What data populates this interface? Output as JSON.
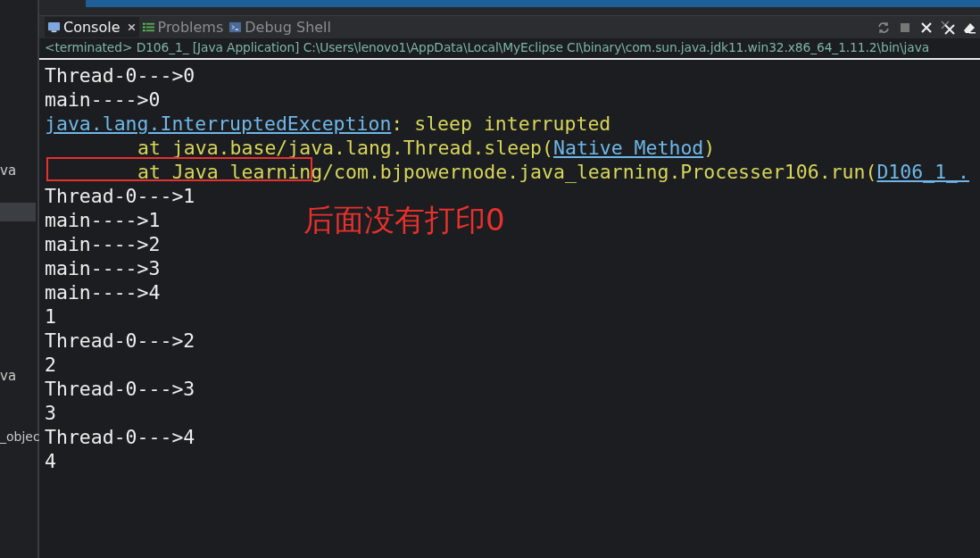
{
  "sidebar": {
    "items": [
      {
        "label": "va",
        "selected": false
      },
      {
        "selected": true
      },
      {
        "label": "va",
        "selected": false
      },
      {
        "label": "_objec",
        "selected": false
      }
    ]
  },
  "tabs": [
    {
      "label": "Console",
      "selected": true,
      "closable": true
    },
    {
      "label": "Problems",
      "selected": false,
      "closable": false
    },
    {
      "label": "Debug Shell",
      "selected": false,
      "closable": false
    }
  ],
  "status_line": "<terminated> D106_1_ [Java Application] C:\\Users\\lenovo1\\AppData\\Local\\MyEclipse CI\\binary\\com.sun.java.jdk11.win32.x86_64_1.11.2\\bin\\java",
  "console_lines": [
    {
      "kind": "line",
      "segments": [
        {
          "kind": "out",
          "text": "Thread-0--->0"
        }
      ]
    },
    {
      "kind": "line",
      "segments": [
        {
          "kind": "out",
          "text": "main---->0"
        }
      ]
    },
    {
      "kind": "line",
      "segments": [
        {
          "kind": "link",
          "text": "java.lang.InterruptedException"
        },
        {
          "kind": "err",
          "text": ": sleep interrupted"
        }
      ]
    },
    {
      "kind": "frame",
      "segments": [
        {
          "kind": "err",
          "text": "at java.base/java.lang.Thread.sleep("
        },
        {
          "kind": "link",
          "text": "Native Method"
        },
        {
          "kind": "err",
          "text": ")"
        }
      ]
    },
    {
      "kind": "frame",
      "segments": [
        {
          "kind": "err",
          "text": "at Java learning/com.bjpowernode.java_learning.Processer106.run("
        },
        {
          "kind": "link",
          "text": "D106_1_."
        }
      ]
    },
    {
      "kind": "line",
      "segments": [
        {
          "kind": "out",
          "text": "Thread-0--->1"
        }
      ]
    },
    {
      "kind": "line",
      "segments": [
        {
          "kind": "out",
          "text": "main---->1"
        }
      ]
    },
    {
      "kind": "line",
      "segments": [
        {
          "kind": "out",
          "text": "main---->2"
        }
      ]
    },
    {
      "kind": "line",
      "segments": [
        {
          "kind": "out",
          "text": "main---->3"
        }
      ]
    },
    {
      "kind": "line",
      "segments": [
        {
          "kind": "out",
          "text": "main---->4"
        }
      ]
    },
    {
      "kind": "line",
      "segments": [
        {
          "kind": "out",
          "text": "1"
        }
      ]
    },
    {
      "kind": "line",
      "segments": [
        {
          "kind": "out",
          "text": "Thread-0--->2"
        }
      ]
    },
    {
      "kind": "line",
      "segments": [
        {
          "kind": "out",
          "text": "2"
        }
      ]
    },
    {
      "kind": "line",
      "segments": [
        {
          "kind": "out",
          "text": "Thread-0--->3"
        }
      ]
    },
    {
      "kind": "line",
      "segments": [
        {
          "kind": "out",
          "text": "3"
        }
      ]
    },
    {
      "kind": "line",
      "segments": [
        {
          "kind": "out",
          "text": "Thread-0--->4"
        }
      ]
    },
    {
      "kind": "line",
      "segments": [
        {
          "kind": "out",
          "text": "4"
        }
      ]
    }
  ],
  "annotation": {
    "text": "后面没有打印0",
    "color": "#e8302c"
  }
}
